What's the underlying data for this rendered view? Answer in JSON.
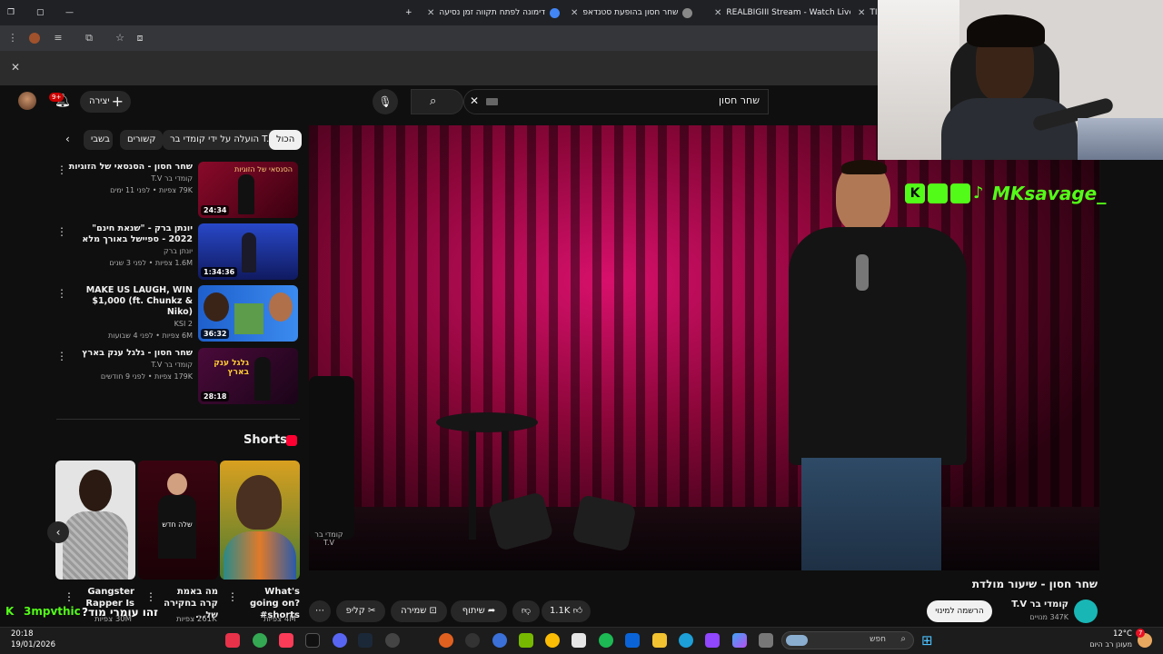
{
  "browser": {
    "tabs": [
      {
        "title": "דימונה לפתח תקווה זמן נסיעה"
      },
      {
        "title": "שחר חסון בהופעת סטנדאפ"
      },
      {
        "title": "REALBIGIII Stream - Watch Live"
      },
      {
        "title": "TI"
      }
    ]
  },
  "youtube": {
    "create_label": "יצירה",
    "notif_count": "9+",
    "search_value": "שחר חסון",
    "filter_chips": [
      "הכול",
      "הועלה על ידי קומדי בר T.V",
      "קשורים",
      "בשבי"
    ],
    "related": [
      {
        "title": "שחר חסון - הסנסאי של הזוגיות",
        "channel": "קומדי בר T.V",
        "meta": "79K צפיות • לפני 11 ימים",
        "duration": "24:34",
        "thumb_text": "הסנסאי של הזוגיות"
      },
      {
        "title": "יונתן ברק - \"שנאת חינם\" 2022 - ספיישל באורך מלא",
        "channel": "יונתן ברק",
        "meta": "1.6M צפיות • לפני 3 שנים",
        "duration": "1:34:36",
        "thumb_text": ""
      },
      {
        "title": "MAKE US LAUGH, WIN $1,000 (ft. Chunkz & Niko)",
        "channel": "KSI 2",
        "meta": "6M צפיות • לפני 4 שבועות",
        "duration": "36:32",
        "thumb_text": ""
      },
      {
        "title": "שחר חסון - גלגל ענק בארץ",
        "channel": "קומדי בר T.V",
        "meta": "179K צפיות • לפני 9 חודשים",
        "duration": "28:18",
        "thumb_text": "גלגל ענק בארץ"
      }
    ],
    "shorts_label": "Shorts",
    "shorts": [
      {
        "title": "What's going on? #shorts",
        "views": "4M צפיות"
      },
      {
        "title": "מה באמת קרה בחקירה של...",
        "views": "261K צפיות"
      },
      {
        "title": "Gangster Rapper Is",
        "views": "30M צפיות"
      }
    ],
    "short_overlay_text": "שלה חדש",
    "video": {
      "title": "שחר חסון - שיעור מולדת",
      "channel": "קומדי בר T.V",
      "subs": "347K מנויים",
      "subscribe_label": "הרשמה למינוי",
      "likes": "1.1K",
      "share_label": "שיתוף",
      "save_label": "שמירה",
      "clip_label": "קליפ",
      "watermark": "קומדי בר T.V"
    }
  },
  "overlay": {
    "streamer_tag": "MKsavage_",
    "chat_user": "3mpvthic",
    "chat_msg": "?זהו עומרי מוד"
  },
  "taskbar": {
    "time": "20:18",
    "date": "19/01/2026",
    "search_placeholder": "חפש",
    "weather_temp": "12°C",
    "weather_desc": "מעונן רב היום",
    "badge": "7"
  }
}
